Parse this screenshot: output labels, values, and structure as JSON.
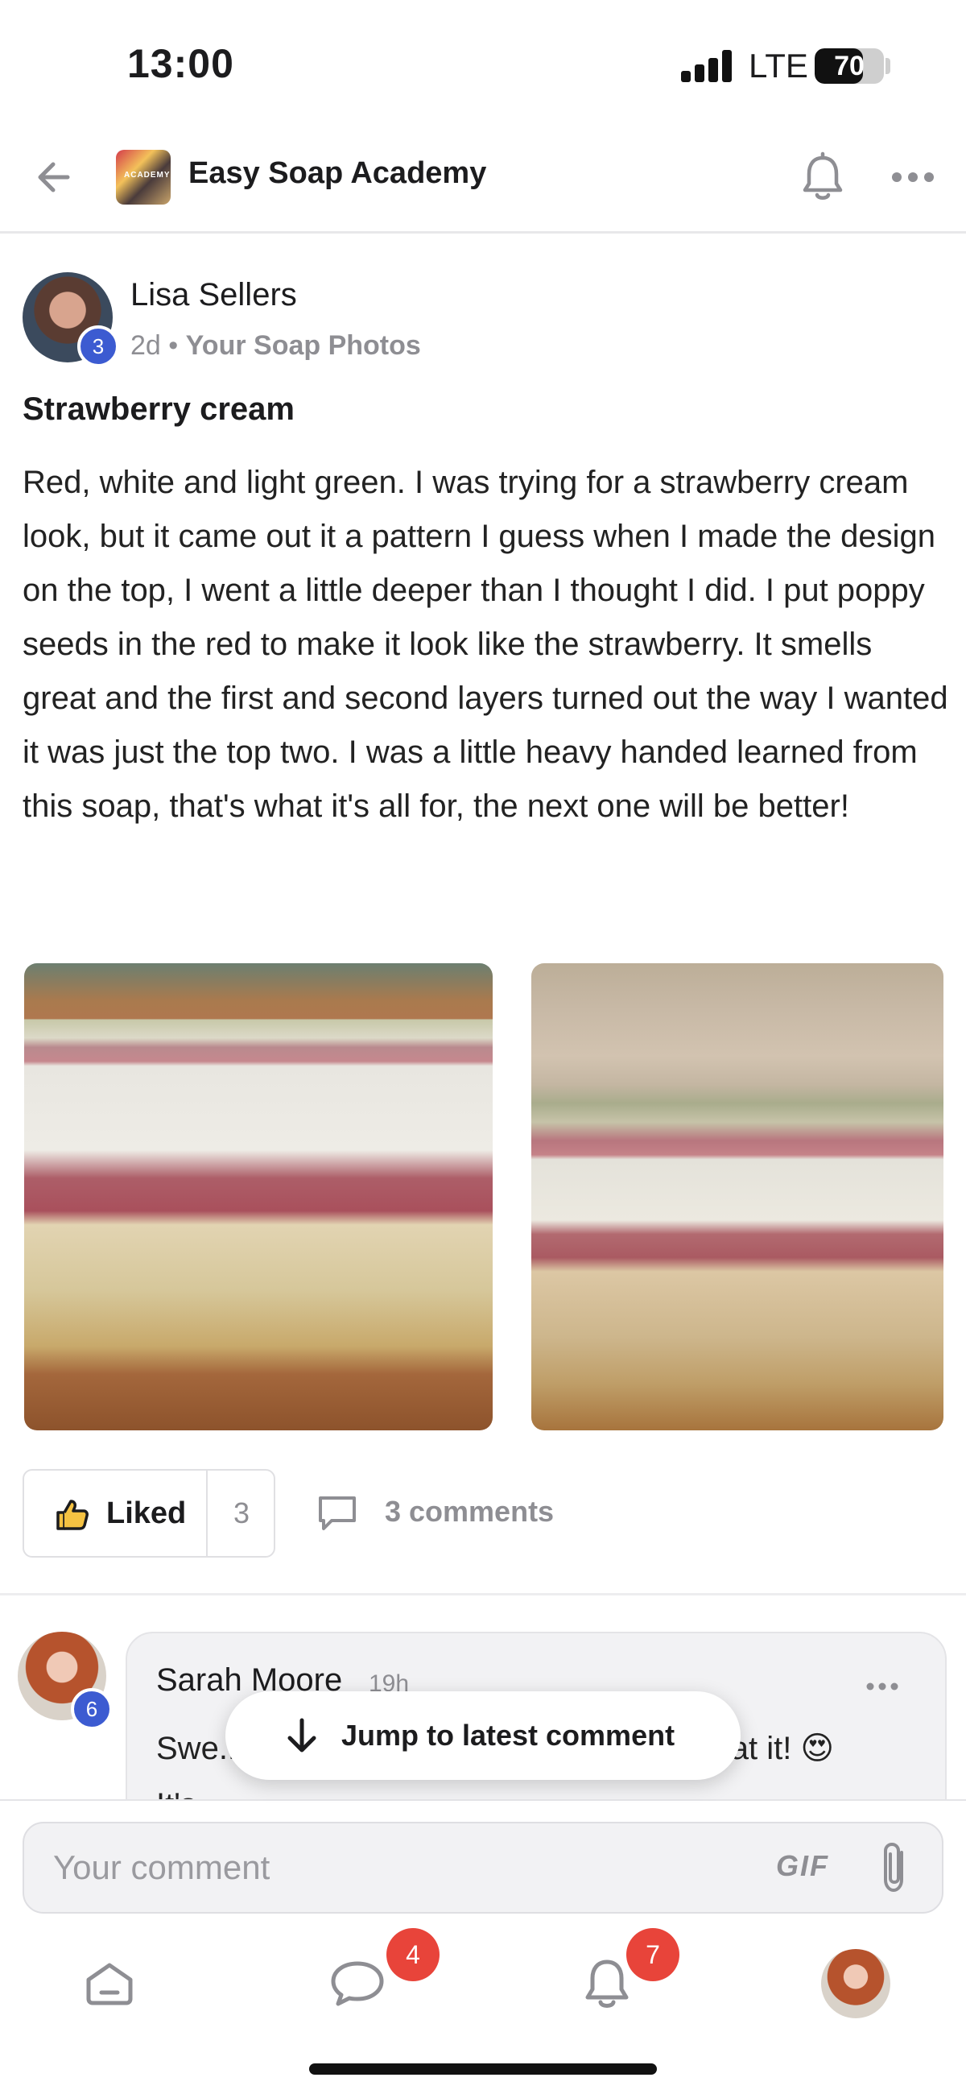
{
  "status_bar": {
    "time": "13:00",
    "network": "LTE",
    "battery": "70",
    "battery_level": 0.7
  },
  "header": {
    "back_icon": "arrow-left-icon",
    "community_name": "Easy Soap Academy",
    "logo_text": "ACADEMY",
    "notification_icon": "bell-off-icon",
    "more_icon": "ellipsis-icon"
  },
  "post": {
    "author": "Lisa Sellers",
    "author_level": "3",
    "time": "2d",
    "separator": "•",
    "category": "Your Soap Photos",
    "title": "Strawberry cream",
    "body": "Red, white and light green. I was trying for a strawberry cream look, but it came out it a pattern I guess when I made the design on the top, I went a little deeper than I thought I did. I put poppy seeds in the red to make it look like the strawberry. It smells great and the first and second layers turned out the way I wanted it was just the top two. I was a little heavy handed learned from this soap, that's what it's all for, the next one will be better!",
    "like_label": "Liked",
    "like_count": "3",
    "comments_label": "3 comments"
  },
  "comment_preview": {
    "author": "Sarah Moore",
    "author_level": "6",
    "time": "19h",
    "text": "Swe... like a cheesecake that I want to eat it! 😍 It's..."
  },
  "jump_button": {
    "label": "Jump to latest comment",
    "icon": "arrow-down-icon"
  },
  "composer": {
    "placeholder": "Your comment",
    "gif_label": "GIF",
    "attach_icon": "paperclip-icon"
  },
  "bottom_nav": {
    "home_icon": "home-icon",
    "chat_icon": "chat-icon",
    "chat_badge": "4",
    "notifications_icon": "bell-icon",
    "notifications_badge": "7",
    "profile_icon": "avatar"
  },
  "colors": {
    "accent_badge": "#3c5bd1",
    "notification_badge": "#e8443a"
  }
}
